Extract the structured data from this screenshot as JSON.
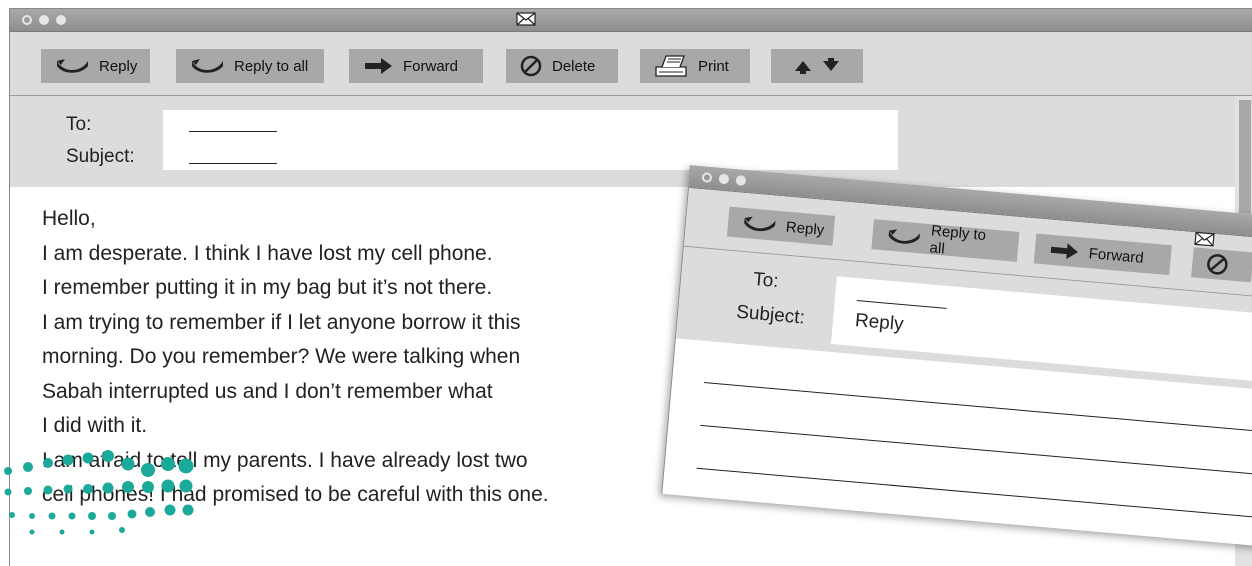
{
  "window": {
    "title_icon": "envelope-icon",
    "toolbar": [
      {
        "label": "Reply",
        "icon": "reply-icon"
      },
      {
        "label": "Reply to all",
        "icon": "reply-all-icon"
      },
      {
        "label": "Forward",
        "icon": "forward-arrow-icon"
      },
      {
        "label": "Delete",
        "icon": "delete-icon"
      },
      {
        "label": "Print",
        "icon": "printer-icon"
      },
      {
        "label": "",
        "icon": "up-down-arrows-icon"
      }
    ],
    "header": {
      "to_label": "To:",
      "subject_label": "Subject:"
    },
    "body": [
      "Hello,",
      "I am desperate. I think I have lost my cell phone.",
      "I remember putting it in my bag but it’s not there.",
      "I am trying to remember if I let anyone borrow it this",
      "morning. Do you remember? We were talking when",
      "Sabah interrupted us and I don’t remember what",
      "I did with it.",
      "I am afraid to tell my parents. I have already lost two",
      "cell phones! I had promised to be careful with this one."
    ]
  },
  "reply_window": {
    "toolbar": [
      {
        "label": "Reply",
        "icon": "reply-icon"
      },
      {
        "label": "Reply to all",
        "icon": "reply-all-icon"
      },
      {
        "label": "Forward",
        "icon": "forward-arrow-icon"
      },
      {
        "label": "",
        "icon": "delete-icon"
      }
    ],
    "title_icon": "envelope-icon",
    "header": {
      "to_label": "To:",
      "subject_label": "Subject:",
      "subject_value": "Reply"
    }
  },
  "colors": {
    "titlebar": "#999999",
    "toolbar_bg": "#dcdcdc",
    "button_bg": "#a8a8a8",
    "logo_teal": "#1ba99a"
  }
}
